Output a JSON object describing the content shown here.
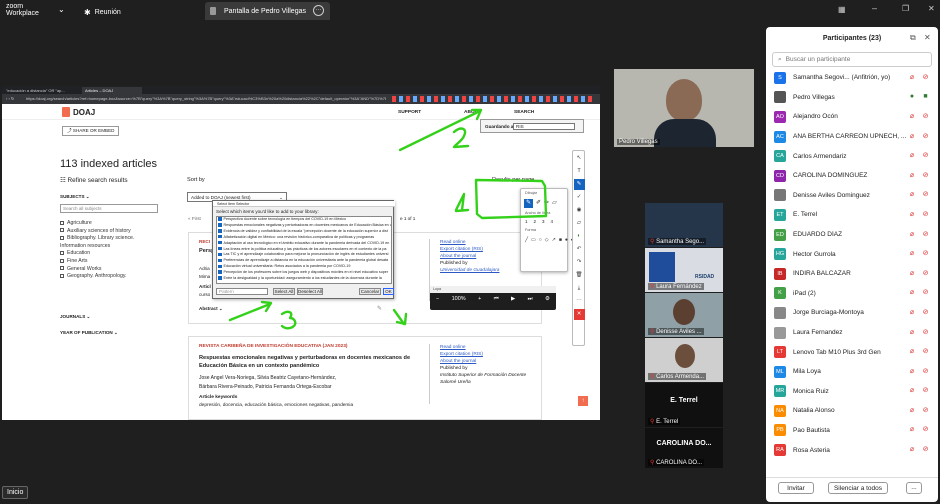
{
  "zoom": {
    "logo_line1": "zoom",
    "logo_line2": "Workplace",
    "meeting_tab": "Reunión",
    "share_tab": "Pantalla de Pedro Villegas",
    "start_button": "Inicio"
  },
  "browser": {
    "tab1": "\"educación a distancia\" OR \"ap...",
    "tab2": "Articles – DOAJ",
    "url": "https://doaj.org/search/articles?ref=homepage-box&source=%7B\"query\"%3A%7B\"query_string\"%3A%7B\"query\"%3A\"educaci%C3%B3n%20a%20distancia%22%2C\"default_operator\"%3A\"AND\"%7D%7D"
  },
  "doaj": {
    "logo": "DOAJ",
    "share_embed": "SHARE OR EMBED",
    "support": "SUPPORT",
    "about": "ABOUT",
    "search": "SEARCH",
    "indexed": "113 indexed articles",
    "refine": "Refine search results",
    "sort_by": "Sort by",
    "sort_value": "Added to DOAJ (newest first)",
    "results_per_page": "Results per page",
    "first": "« First",
    "page_of": "e 1 of 1",
    "subjects_header": "SUBJECTS",
    "subjects_search": "Search all subjects",
    "subjects": [
      "Agriculture",
      "Auxiliary sciences of history",
      "Bibliography. Library science. Information resources",
      "Education",
      "Fine Arts",
      "General Works",
      "Geography. Anthropology."
    ],
    "journals": "JOURNALS",
    "year": "YEAR OF PUBLICATION",
    "guardar_label": "Guardando a",
    "guardar_value": "RIS",
    "article1": {
      "source": "RECI",
      "title_fragment": "Persp",
      "authors_fragment": "Adria",
      "authors2_fragment": "Mima",
      "keywords_fragment": "Articl",
      "keywords2_fragment": "curso",
      "abstract": "Abstract",
      "read_online": "Read online",
      "export": "Export citation (RIS)",
      "about_journal": "About the journal",
      "published_by": "Published by",
      "publisher": "Universidad de Guadalajara"
    },
    "article2": {
      "source": "REVISTA CARIBEÑA DE INVESTIGACIÓN EDUCATIVA (JAN 2023)",
      "title": "Respuestas emocionales negativas y perturbadoras en docentes mexicanos de Educación Básica en un contexto pandémico",
      "authors1": "Jose Angel Vera-Noriega, Silvia Beatriz Cayetano-Hernández,",
      "authors2": "Bárbara Rivera-Peinado, Patricia Fernanda Ortega-Escobar",
      "keywords_label": "Article keywords",
      "keywords": "depresión, docencia, educación básica, emociones negativas, pandemia",
      "read_online": "Read online",
      "export": "Export citation (RIS)",
      "about_journal": "About the journal",
      "published_by": "Published by",
      "publisher": "Instituto Superior de Formación Docente Salomé Ureña"
    }
  },
  "dialog": {
    "title": "Select Item Selector",
    "instruction": "Select which items you'd like to add to your library:",
    "items": [
      "Perspectiva docente sobre tecnología en tiempos del COVID-19 en México",
      "Respuestas emocionales negativas y perturbadoras en docentes mexicanos de Educación Básica en u",
      "Evidencia de validez y confiabilidad de la escala \"percepción docente de la educación superior a dist",
      "Alfabetización digital en México: una revisión histórico-comparativa de políticas y programas",
      "Adaptación al uso tecnológico en el ámbito educativo durante la pandemia derivada del COVID-19 en",
      "Las líneas entre la política educativa y las prácticas de los actores escolares en el contexto de la pa",
      "Las TIC y el aprendizaje colaborativo para mejorar la pronunciación de inglés de estudiantes universi",
      "Preferencias de aprendizaje a distancia en la educación universitaria ante la pandemia global desata",
      "Educación virtual universitaria: Retos asociados a la pandemia por COVID-19",
      "Percepción de los profesores sobre los juegos web y dispositivos móviles en el nivel educativo super",
      "Entre la desigualdad y la oportunidad: aseguramiento a los estudiantes de la docencia durante la"
    ],
    "pattern_placeholder": "Pattern",
    "select_all": "Select All",
    "deselect_all": "Deselect All",
    "cancel": "Cancelar",
    "ok": "OK"
  },
  "drawing_tool": {
    "header": "Dibujar",
    "width_label": "Ancho de línea",
    "shapes_label": "Forma",
    "widths": [
      "1",
      "2",
      "3",
      "4"
    ]
  },
  "video_player": {
    "title": "Lupa",
    "zoom": "100%"
  },
  "annotations": [
    "1",
    "2",
    "3"
  ],
  "video": {
    "main_name": "Pedro Villegas",
    "tiles": [
      "Samantha Sego...",
      "Laura Fernández",
      "Denisse Aviles ...",
      "Carlos Armenda..."
    ],
    "tile_uni_text": "RSIDAD",
    "e_terrel": "E. Terrel",
    "carolina_big": "CAROLINA DO...",
    "carolina_small": "CAROLINA DO..."
  },
  "participants": {
    "title": "Participantes (23)",
    "search_placeholder": "Buscar un participante",
    "invite": "Invitar",
    "mute_all": "Silenciar a todos",
    "more": "...",
    "list": [
      {
        "initials": "S",
        "name": "Samantha Segovi... (Anfitrión, yo)",
        "color": "#1a73e8"
      },
      {
        "initials": "",
        "name": "Pedro Villegas",
        "color": "#555"
      },
      {
        "initials": "AO",
        "name": "Alejandro Ocón",
        "color": "#9c27b0"
      },
      {
        "initials": "AC",
        "name": "ANA BERTHA CARREON UPNECH, ...",
        "color": "#1e88e5"
      },
      {
        "initials": "CA",
        "name": "Carlos Armendariz",
        "color": "#26a69a"
      },
      {
        "initials": "CD",
        "name": "CAROLINA DOMINGUEZ",
        "color": "#8e24aa"
      },
      {
        "initials": "",
        "name": "Denisse Aviles Dominguez",
        "color": "#777"
      },
      {
        "initials": "ET",
        "name": "E. Terrel",
        "color": "#26a69a"
      },
      {
        "initials": "ED",
        "name": "EDUARDO DÍAZ",
        "color": "#43a047"
      },
      {
        "initials": "HG",
        "name": "Hector Gurrola",
        "color": "#26a69a"
      },
      {
        "initials": "IB",
        "name": "INDIRA BALCÁZAR",
        "color": "#c62828"
      },
      {
        "initials": "K",
        "name": "iPad (2)",
        "color": "#43a047"
      },
      {
        "initials": "",
        "name": "Jorge Burciaga-Montoya",
        "color": "#888"
      },
      {
        "initials": "",
        "name": "Laura Fernandez",
        "color": "#999"
      },
      {
        "initials": "LT",
        "name": "Lenovo Tab M10 Plus 3rd Gen",
        "color": "#e53935"
      },
      {
        "initials": "ML",
        "name": "Mila Loya",
        "color": "#1e88e5"
      },
      {
        "initials": "MR",
        "name": "Monica Ruiz",
        "color": "#26a69a"
      },
      {
        "initials": "NA",
        "name": "Natalia Alonso",
        "color": "#fb8c00"
      },
      {
        "initials": "PB",
        "name": "Pao Bautista",
        "color": "#fb8c00"
      },
      {
        "initials": "RA",
        "name": "Rosa Asteria",
        "color": "#e53935"
      }
    ]
  },
  "colors": {
    "zoom_bg": "#1f1f1f",
    "annotation": "#34d11a",
    "doaj_orange": "#f26c4f",
    "toolbar_red": "#e53935"
  }
}
